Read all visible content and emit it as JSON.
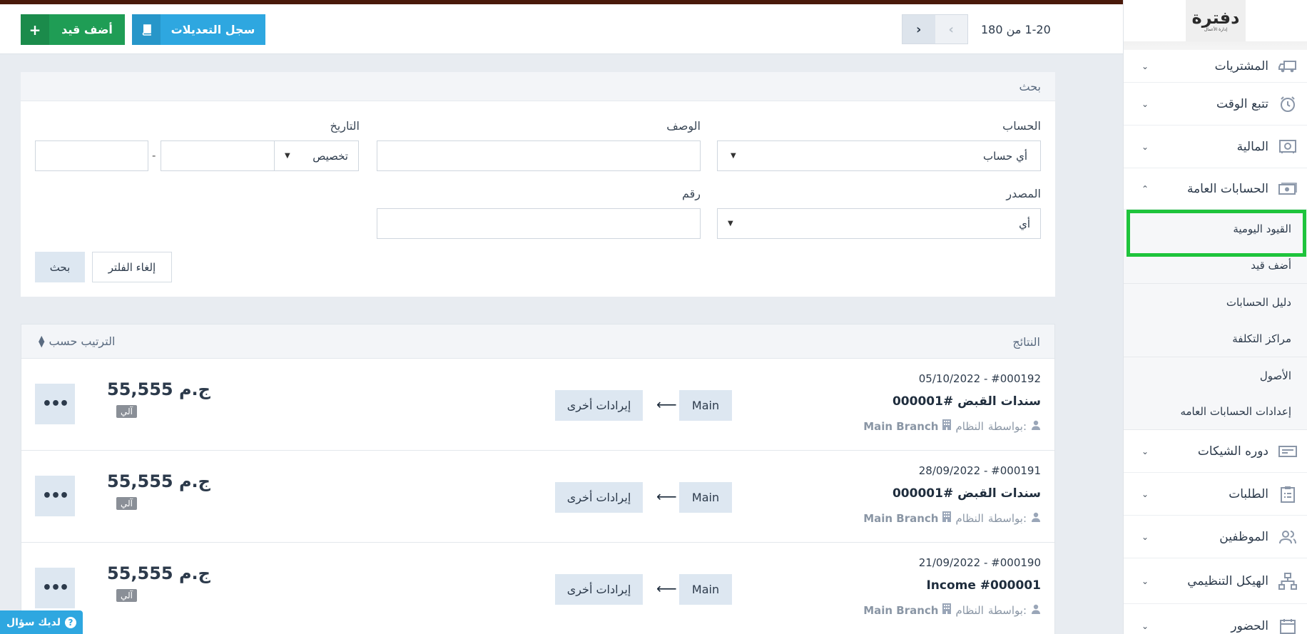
{
  "topbar": {
    "add_entry_label": "أضف قيد",
    "log_label": "سجل التعديلات",
    "pager_text": "1-20  من 180"
  },
  "search": {
    "title": "بحث",
    "account_label": "الحساب",
    "account_value": "أي حساب",
    "description_label": "الوصف",
    "date_label": "التاريخ",
    "date_type_value": "تخصيص",
    "date_separator": "-",
    "source_label": "المصدر",
    "source_value": "أي",
    "number_label": "رقم",
    "clear_label": "إلغاء الفلتر",
    "search_label": "بحث"
  },
  "results": {
    "title": "النتائج",
    "sort_label": "الترتيب حسب",
    "rows": [
      {
        "meta": "05/10/2022 - #000192",
        "title": "سندات القبض #000001",
        "by_label": "بواسطة:",
        "by_value": "النظام",
        "branch": "Main Branch",
        "from_account": "Main",
        "to_account": "إيرادات أخرى",
        "amount": "55,555 ج.م",
        "badge": "آلي"
      },
      {
        "meta": "28/09/2022 - #000191",
        "title": "سندات القبض #000001",
        "by_label": "بواسطة:",
        "by_value": "النظام",
        "branch": "Main Branch",
        "from_account": "Main",
        "to_account": "إيرادات أخرى",
        "amount": "55,555 ج.م",
        "badge": "آلي"
      },
      {
        "meta": "21/09/2022 - #000190",
        "title": "Income #000001",
        "by_label": "بواسطة:",
        "by_value": "النظام",
        "branch": "Main Branch",
        "from_account": "Main",
        "to_account": "إيرادات أخرى",
        "amount": "55,555 ج.م",
        "badge": "آلي"
      }
    ]
  },
  "sidebar": {
    "logo_text": "دفترة",
    "logo_sub": "إدارة الأعمال",
    "items": [
      {
        "label": "المشتريات",
        "icon": "truck-icon"
      },
      {
        "label": "تتبع الوقت",
        "icon": "clock-icon"
      },
      {
        "label": "المالية",
        "icon": "safe-icon"
      },
      {
        "label": "الحسابات العامة",
        "icon": "money-icon"
      }
    ],
    "sub_items": [
      "القيود اليومية",
      "أضف قيد",
      "دليل الحسابات",
      "مراكز التكلفة",
      "الأصول",
      "إعدادات الحسابات العامه"
    ],
    "items2": [
      {
        "label": "دوره الشيكات",
        "icon": "cheque-icon"
      },
      {
        "label": "الطلبات",
        "icon": "clipboard-icon"
      },
      {
        "label": "الموظفين",
        "icon": "users-icon"
      },
      {
        "label": "الهيكل التنظيمي",
        "icon": "sitemap-icon"
      },
      {
        "label": "الحضور",
        "icon": "calendar-icon"
      }
    ]
  },
  "help": {
    "label": "لديك سؤال"
  },
  "colors": {
    "green": "#1f9d55",
    "blue": "#2ea7e0",
    "highlight": "#1ec43c"
  }
}
